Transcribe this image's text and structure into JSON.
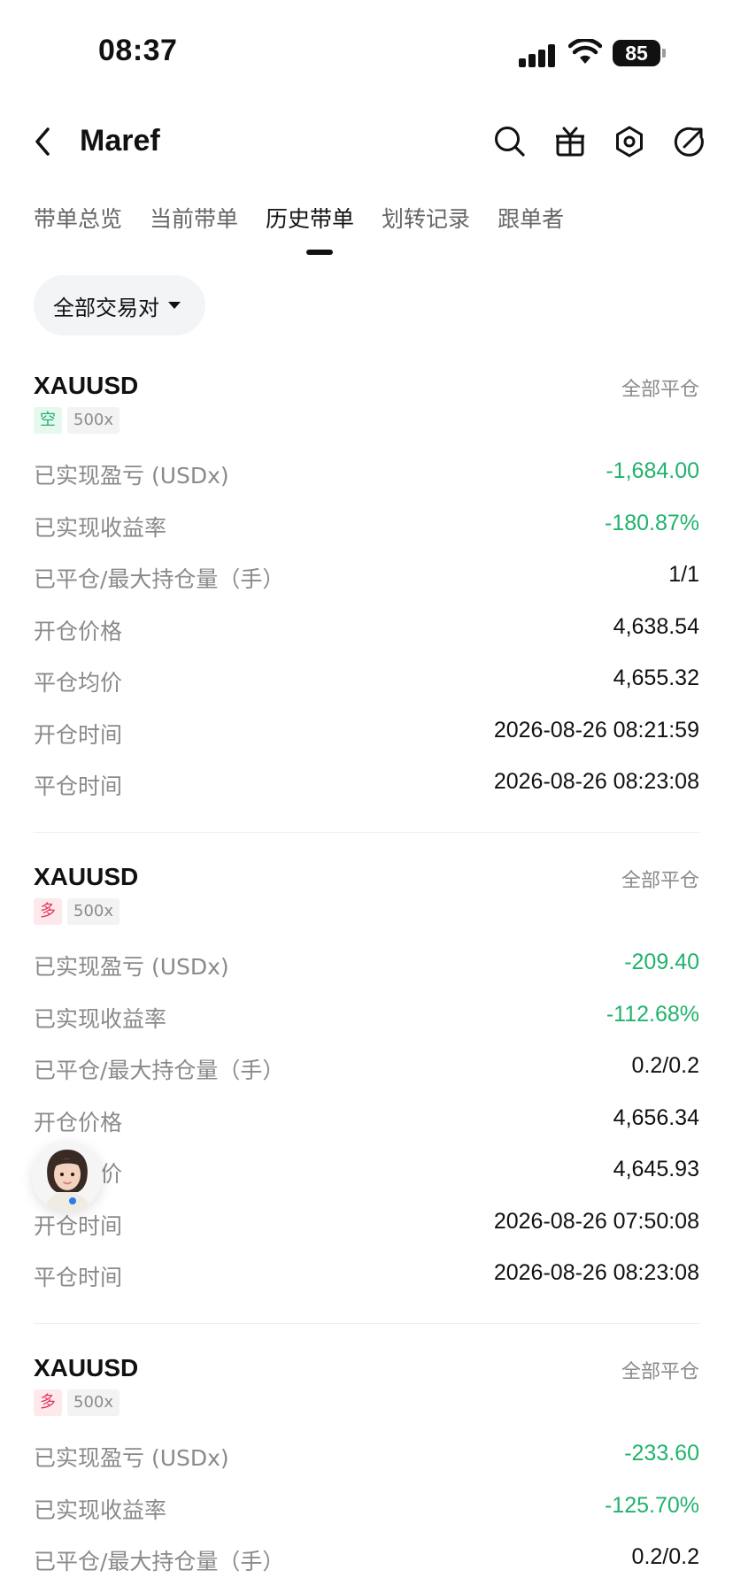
{
  "status_bar": {
    "time": "08:37",
    "battery": "85"
  },
  "header": {
    "title": "Maref"
  },
  "tabs": [
    {
      "label": "带单总览"
    },
    {
      "label": "当前带单"
    },
    {
      "label": "历史带单"
    },
    {
      "label": "划转记录"
    },
    {
      "label": "跟单者"
    }
  ],
  "filter": {
    "label": "全部交易对"
  },
  "orders": [
    {
      "symbol": "XAUUSD",
      "close_type": "全部平仓",
      "side": "空",
      "leverage": "500x",
      "rows": [
        {
          "label": "已实现盈亏 (USDx)",
          "value": "-1,684.00"
        },
        {
          "label": "已实现收益率",
          "value": "-180.87%"
        },
        {
          "label": "已平仓/最大持仓量（手）",
          "value": "1/1"
        },
        {
          "label": "开仓价格",
          "value": "4,638.54"
        },
        {
          "label": "平仓均价",
          "value": "4,655.32"
        },
        {
          "label": "开仓时间",
          "value": "2026-08-26 08:21:59"
        },
        {
          "label": "平仓时间",
          "value": "2026-08-26 08:23:08"
        }
      ]
    },
    {
      "symbol": "XAUUSD",
      "close_type": "全部平仓",
      "side": "多",
      "leverage": "500x",
      "rows": [
        {
          "label": "已实现盈亏 (USDx)",
          "value": "-209.40"
        },
        {
          "label": "已实现收益率",
          "value": "-112.68%"
        },
        {
          "label": "已平仓/最大持仓量（手）",
          "value": "0.2/0.2"
        },
        {
          "label": "开仓价格",
          "value": "4,656.34"
        },
        {
          "label": "平仓均价",
          "value": "4,645.93"
        },
        {
          "label": "开仓时间",
          "value": "2026-08-26 07:50:08"
        },
        {
          "label": "平仓时间",
          "value": "2026-08-26 08:23:08"
        }
      ]
    },
    {
      "symbol": "XAUUSD",
      "close_type": "全部平仓",
      "side": "多",
      "leverage": "500x",
      "rows": [
        {
          "label": "已实现盈亏 (USDx)",
          "value": "-233.60"
        },
        {
          "label": "已实现收益率",
          "value": "-125.70%"
        },
        {
          "label": "已平仓/最大持仓量（手）",
          "value": "0.2/0.2"
        }
      ]
    }
  ],
  "colors": {
    "negative": "#20b36b",
    "short_tag": "#20b36b",
    "long_tag": "#e0365a",
    "muted_text": "#8a8a8a"
  },
  "icons": [
    "signal-icon",
    "wifi-icon",
    "battery-icon",
    "back-icon",
    "search-icon",
    "gift-icon",
    "settings-icon",
    "share-icon",
    "assistant-avatar"
  ]
}
